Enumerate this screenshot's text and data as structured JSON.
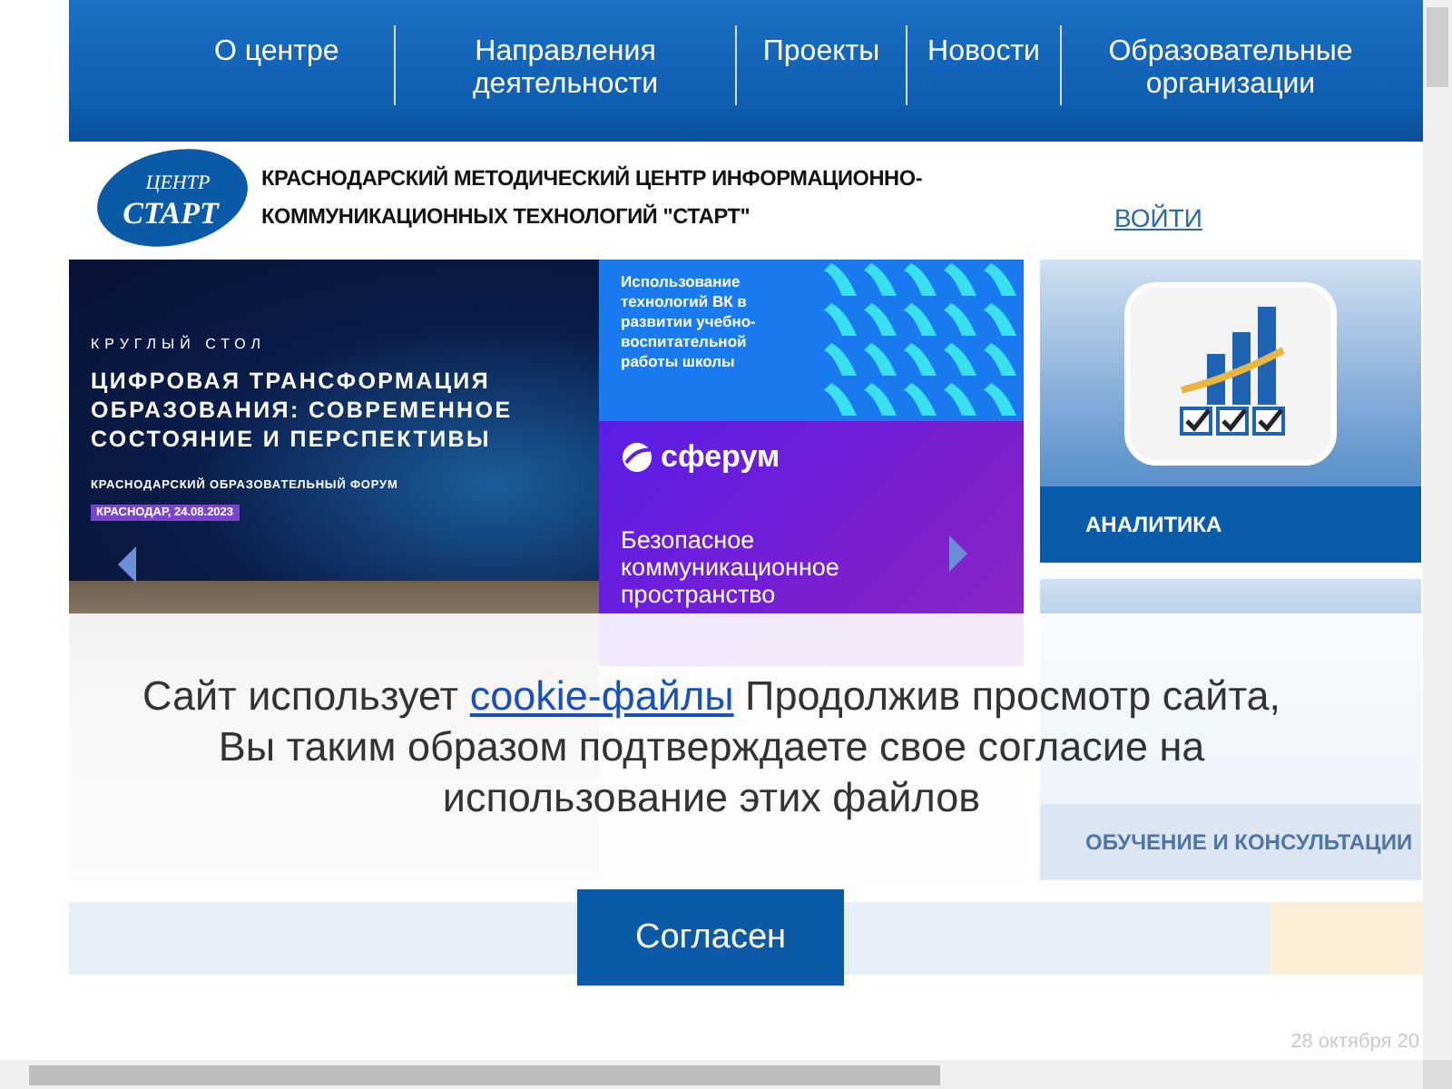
{
  "nav": [
    {
      "label": "О центре"
    },
    {
      "label": "Направления деятельности"
    },
    {
      "label": "Проекты"
    },
    {
      "label": "Новости"
    },
    {
      "label": "Образовательные организации"
    }
  ],
  "header": {
    "logo_top": "ЦЕНТР",
    "logo_bottom": "СТАРТ",
    "title": "КРАСНОДАРСКИЙ МЕТОДИЧЕСКИЙ ЦЕНТР ИНФОРМАЦИОННО-КОММУНИКАЦИОННЫХ ТЕХНОЛОГИЙ \"СТАРТ\"",
    "login": "ВОЙТИ"
  },
  "slider": {
    "forum_banner": {
      "kicker": "КРУГЛЫЙ СТОЛ",
      "headline": "ЦИФРОВАЯ ТРАНСФОРМАЦИЯ ОБРАЗОВАНИЯ: СОВРЕМЕННОЕ СОСТОЯНИЕ И ПЕРСПЕКТИВЫ",
      "event": "КРАСНОДАРСКИЙ ОБРАЗОВАТЕЛЬНЫЙ ФОРУМ",
      "place_date": "КРАСНОДАР, 24.08.2023"
    },
    "vk_banner": {
      "text": "Использование технологий ВК в развитии учебно-воспитательной работы школы"
    },
    "sferum_banner": {
      "brand": "сферум",
      "headline": "Безопасное коммуникационное пространство"
    }
  },
  "tiles": [
    {
      "label": "АНАЛИТИКА"
    },
    {
      "label": "ОБУЧЕНИЕ И КОНСУЛЬТАЦИИ"
    }
  ],
  "date": "28 октября 20",
  "cookie": {
    "text_before": "Сайт использует ",
    "link": "cookie-файлы",
    "text_after": " Продолжив просмотр сайта, Вы таким образом подтверждаете свое согласие на использование этих файлов",
    "button": "Согласен"
  }
}
